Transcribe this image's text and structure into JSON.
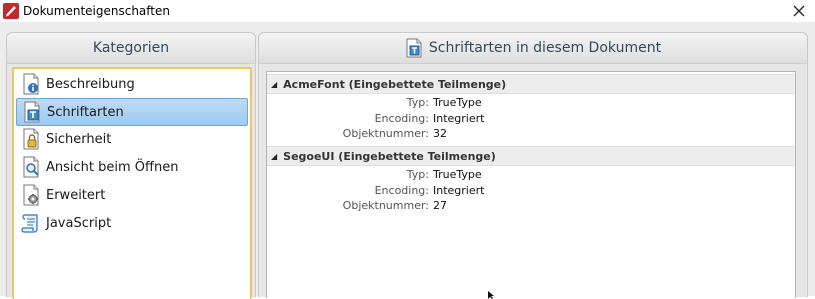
{
  "window": {
    "title": "Dokumenteigenschaften"
  },
  "categories": {
    "header": "Kategorien",
    "items": [
      {
        "label": "Beschreibung",
        "icon": "document-info-icon"
      },
      {
        "label": "Schriftarten",
        "icon": "document-font-icon",
        "selected": true
      },
      {
        "label": "Sicherheit",
        "icon": "document-lock-icon"
      },
      {
        "label": "Ansicht beim Öffnen",
        "icon": "document-magnifier-icon"
      },
      {
        "label": "Erweitert",
        "icon": "document-gear-icon"
      },
      {
        "label": "JavaScript",
        "icon": "script-scroll-icon"
      }
    ]
  },
  "fonts_panel": {
    "header": "Schriftarten in diesem Dokument",
    "fonts": [
      {
        "name": "AcmeFont (Eingebettete Teilmenge)",
        "props": [
          {
            "label": "Typ:",
            "value": "TrueType"
          },
          {
            "label": "Encoding:",
            "value": "Integriert"
          },
          {
            "label": "Objektnummer:",
            "value": "32"
          }
        ]
      },
      {
        "name": "SegoeUI (Eingebettete Teilmenge)",
        "props": [
          {
            "label": "Typ:",
            "value": "TrueType"
          },
          {
            "label": "Encoding:",
            "value": "Integriert"
          },
          {
            "label": "Objektnummer:",
            "value": "27"
          }
        ]
      }
    ]
  },
  "colors": {
    "accent_selection": "#9ecbf0",
    "list_border": "#efc75e",
    "header_text": "#2e4a63"
  }
}
